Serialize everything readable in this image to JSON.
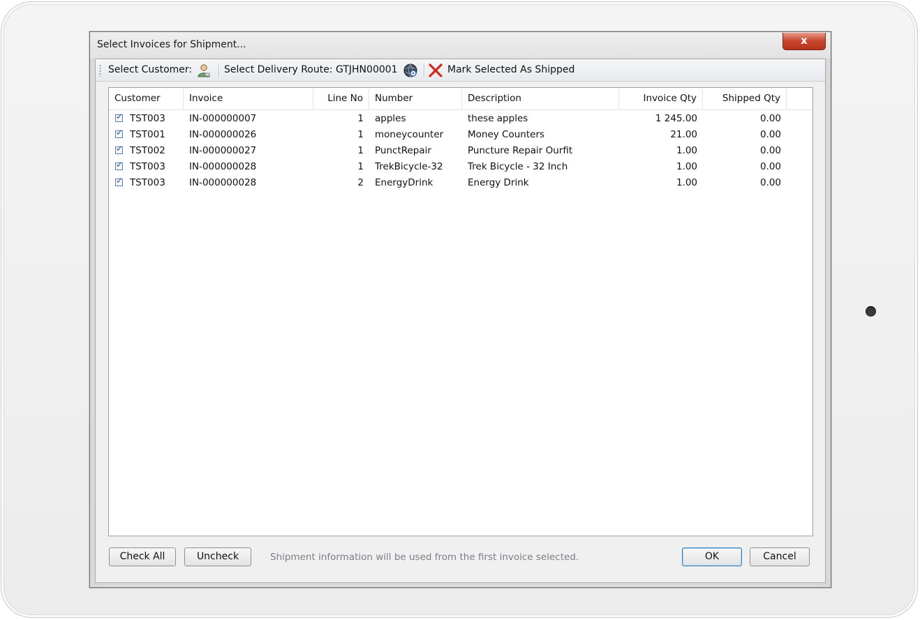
{
  "window": {
    "title": "Select Invoices for Shipment...",
    "close_label": "x"
  },
  "toolbar": {
    "select_customer_label": "Select Customer:",
    "select_route_label": "Select Delivery Route:",
    "route_value": "GTJHN00001",
    "mark_shipped_label": "Mark Selected As Shipped"
  },
  "grid": {
    "columns": [
      "Customer",
      "Invoice",
      "Line No",
      "Number",
      "Description",
      "Invoice Qty",
      "Shipped Qty"
    ],
    "rows": [
      {
        "checked": true,
        "customer": "TST003",
        "invoice": "IN-000000007",
        "line_no": "1",
        "number": "apples",
        "description": "these apples",
        "invoice_qty": "1 245.00",
        "shipped_qty": "0.00"
      },
      {
        "checked": true,
        "customer": "TST001",
        "invoice": "IN-000000026",
        "line_no": "1",
        "number": "moneycounter",
        "description": "Money Counters",
        "invoice_qty": "21.00",
        "shipped_qty": "0.00"
      },
      {
        "checked": true,
        "customer": "TST002",
        "invoice": "IN-000000027",
        "line_no": "1",
        "number": "PunctRepair",
        "description": "Puncture Repair Ourfit",
        "invoice_qty": "1.00",
        "shipped_qty": "0.00"
      },
      {
        "checked": true,
        "customer": "TST003",
        "invoice": "IN-000000028",
        "line_no": "1",
        "number": "TrekBicycle-32",
        "description": "Trek Bicycle - 32 Inch",
        "invoice_qty": "1.00",
        "shipped_qty": "0.00"
      },
      {
        "checked": true,
        "customer": "TST003",
        "invoice": "IN-000000028",
        "line_no": "2",
        "number": "EnergyDrink",
        "description": "Energy Drink",
        "invoice_qty": "1.00",
        "shipped_qty": "0.00"
      }
    ]
  },
  "footer": {
    "check_all_label": "Check All",
    "uncheck_label": "Uncheck",
    "note": "Shipment information will be used from the first invoice selected.",
    "ok_label": "OK",
    "cancel_label": "Cancel"
  },
  "icons": {
    "customer": "user-icon",
    "route": "globe-route-icon",
    "mark": "red-x-icon",
    "check": "checkbox-checked-icon"
  },
  "colors": {
    "close_button": "#c8452d",
    "mark_x": "#d0281c",
    "default_button_border": "#3c7fb1"
  }
}
